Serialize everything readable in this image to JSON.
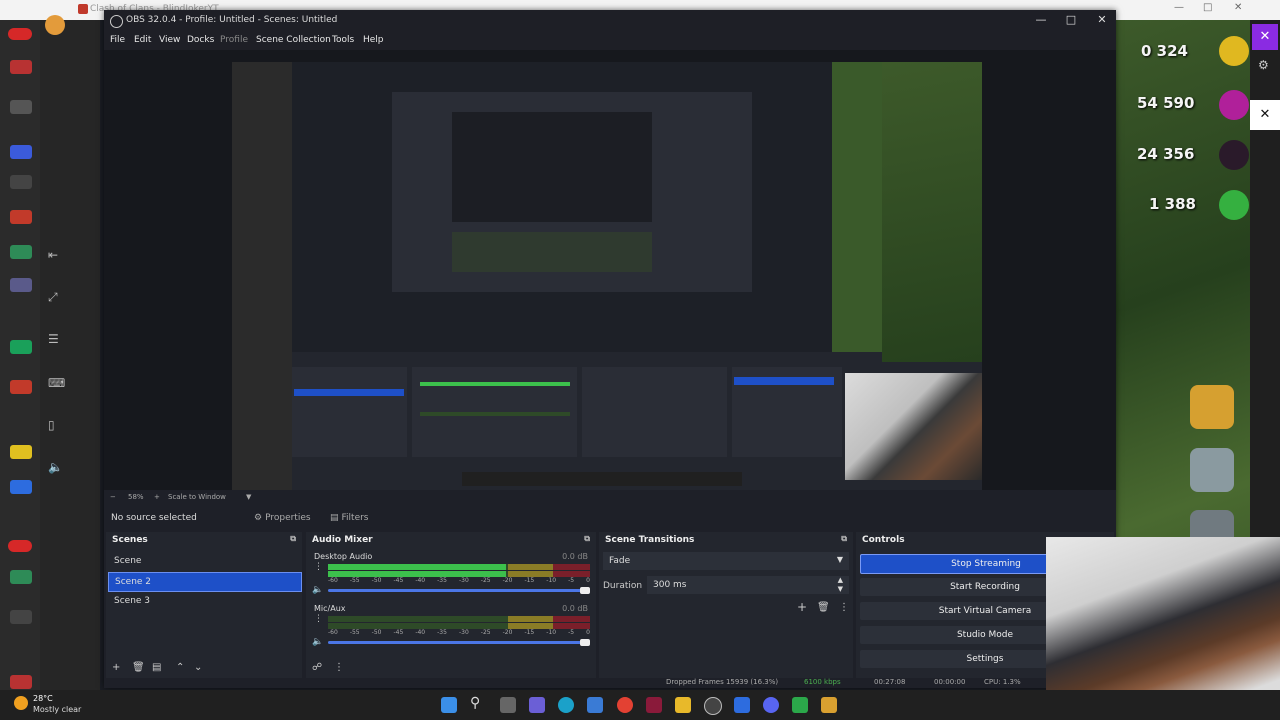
{
  "browser": {
    "tab_title": "Clash of Clans - BlindJokerYT"
  },
  "obs": {
    "title": "OBS 32.0.4 - Profile: Untitled - Scenes: Untitled",
    "menu": [
      "File",
      "Edit",
      "View",
      "Docks",
      "Profile",
      "Scene Collection",
      "Tools",
      "Help"
    ],
    "scale_percent": "58%",
    "scale_mode": "Scale to Window",
    "no_source": "No source selected",
    "properties_label": "Properties",
    "filters_label": "Filters",
    "scenes": {
      "title": "Scenes",
      "items": [
        "Scene",
        "Scene 2",
        "Scene 3"
      ],
      "selected": "Scene 2"
    },
    "mixer": {
      "title": "Audio Mixer",
      "channels": [
        {
          "name": "Desktop Audio",
          "db": "0.0 dB",
          "level": 0.68
        },
        {
          "name": "Mic/Aux",
          "db": "0.0 dB",
          "level": 0.0
        }
      ],
      "ticks": [
        "-60",
        "-55",
        "-50",
        "-45",
        "-40",
        "-35",
        "-30",
        "-25",
        "-20",
        "-15",
        "-10",
        "-5",
        "0"
      ]
    },
    "transitions": {
      "title": "Scene Transitions",
      "selected": "Fade",
      "duration_label": "Duration",
      "duration_value": "300 ms"
    },
    "controls": {
      "title": "Controls",
      "buttons": [
        "Stop Streaming",
        "Start Recording",
        "Start Virtual Camera",
        "Studio Mode",
        "Settings"
      ]
    },
    "status": {
      "dropped": "Dropped Frames 15939 (16.3%)",
      "kbps": "6100 kbps",
      "stream_time": "00:27:08",
      "rec_time": "00:00:00",
      "cpu": "CPU: 1.3%"
    }
  },
  "game": {
    "values": [
      "0 324",
      "54 590",
      "24 356",
      "1 388"
    ]
  },
  "taskbar": {
    "temperature": "28°C",
    "weather": "Mostly clear"
  },
  "colors": {
    "accent": "#1e50c8",
    "panel": "#23262e",
    "meter_green": "#3cc04c"
  }
}
